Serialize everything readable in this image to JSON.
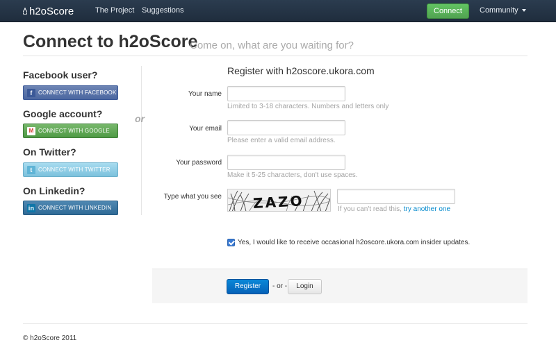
{
  "navbar": {
    "brand": "h2oScore",
    "links": [
      "The Project",
      "Suggestions"
    ],
    "connect_label": "Connect",
    "community_label": "Community"
  },
  "header": {
    "title": "Connect to h2oScore",
    "subtitle": "Come on, what are you waiting for?"
  },
  "social": {
    "or_label": "or",
    "items": [
      {
        "heading": "Facebook user?",
        "button": "CONNECT WITH FACEBOOK",
        "icon": "facebook-icon",
        "color": "#3b5998"
      },
      {
        "heading": "Google account?",
        "button": "CONNECT WITH GOOGLE",
        "icon": "gmail-icon",
        "color": "#4e9a45"
      },
      {
        "heading": "On Twitter?",
        "button": "CONNECT WITH TWITTER",
        "icon": "twitter-icon",
        "color": "#7cc2dd"
      },
      {
        "heading": "On Linkedin?",
        "button": "CONNECT WITH LINKEDIN",
        "icon": "linkedin-icon",
        "color": "#2f6a96"
      }
    ]
  },
  "form": {
    "title": "Register with h2oscore.ukora.com",
    "name": {
      "label": "Your name",
      "value": "",
      "help": "Limited to 3-18 characters. Numbers and letters only"
    },
    "email": {
      "label": "Your email",
      "value": "",
      "help": "Please enter a valid email address."
    },
    "password": {
      "label": "Your password",
      "value": "",
      "help": "Make it 5-25 characters, don't use spaces."
    },
    "captcha": {
      "label": "Type what you see",
      "image_text": "ZAZO",
      "value": "",
      "help": "If you can't read this,",
      "link": "try another one"
    },
    "optin": {
      "checked": true,
      "label": "Yes, I would like to receive occasional h2oscore.ukora.com insider updates."
    }
  },
  "actions": {
    "register_label": "Register",
    "or_text": "- or -",
    "login_label": "Login"
  },
  "footer": {
    "text": "© h2oScore 2011"
  },
  "colors": {
    "navbar": "#1f2d3d",
    "connect": "#51a351",
    "register": "#0561b8",
    "link": "#0088cc"
  }
}
